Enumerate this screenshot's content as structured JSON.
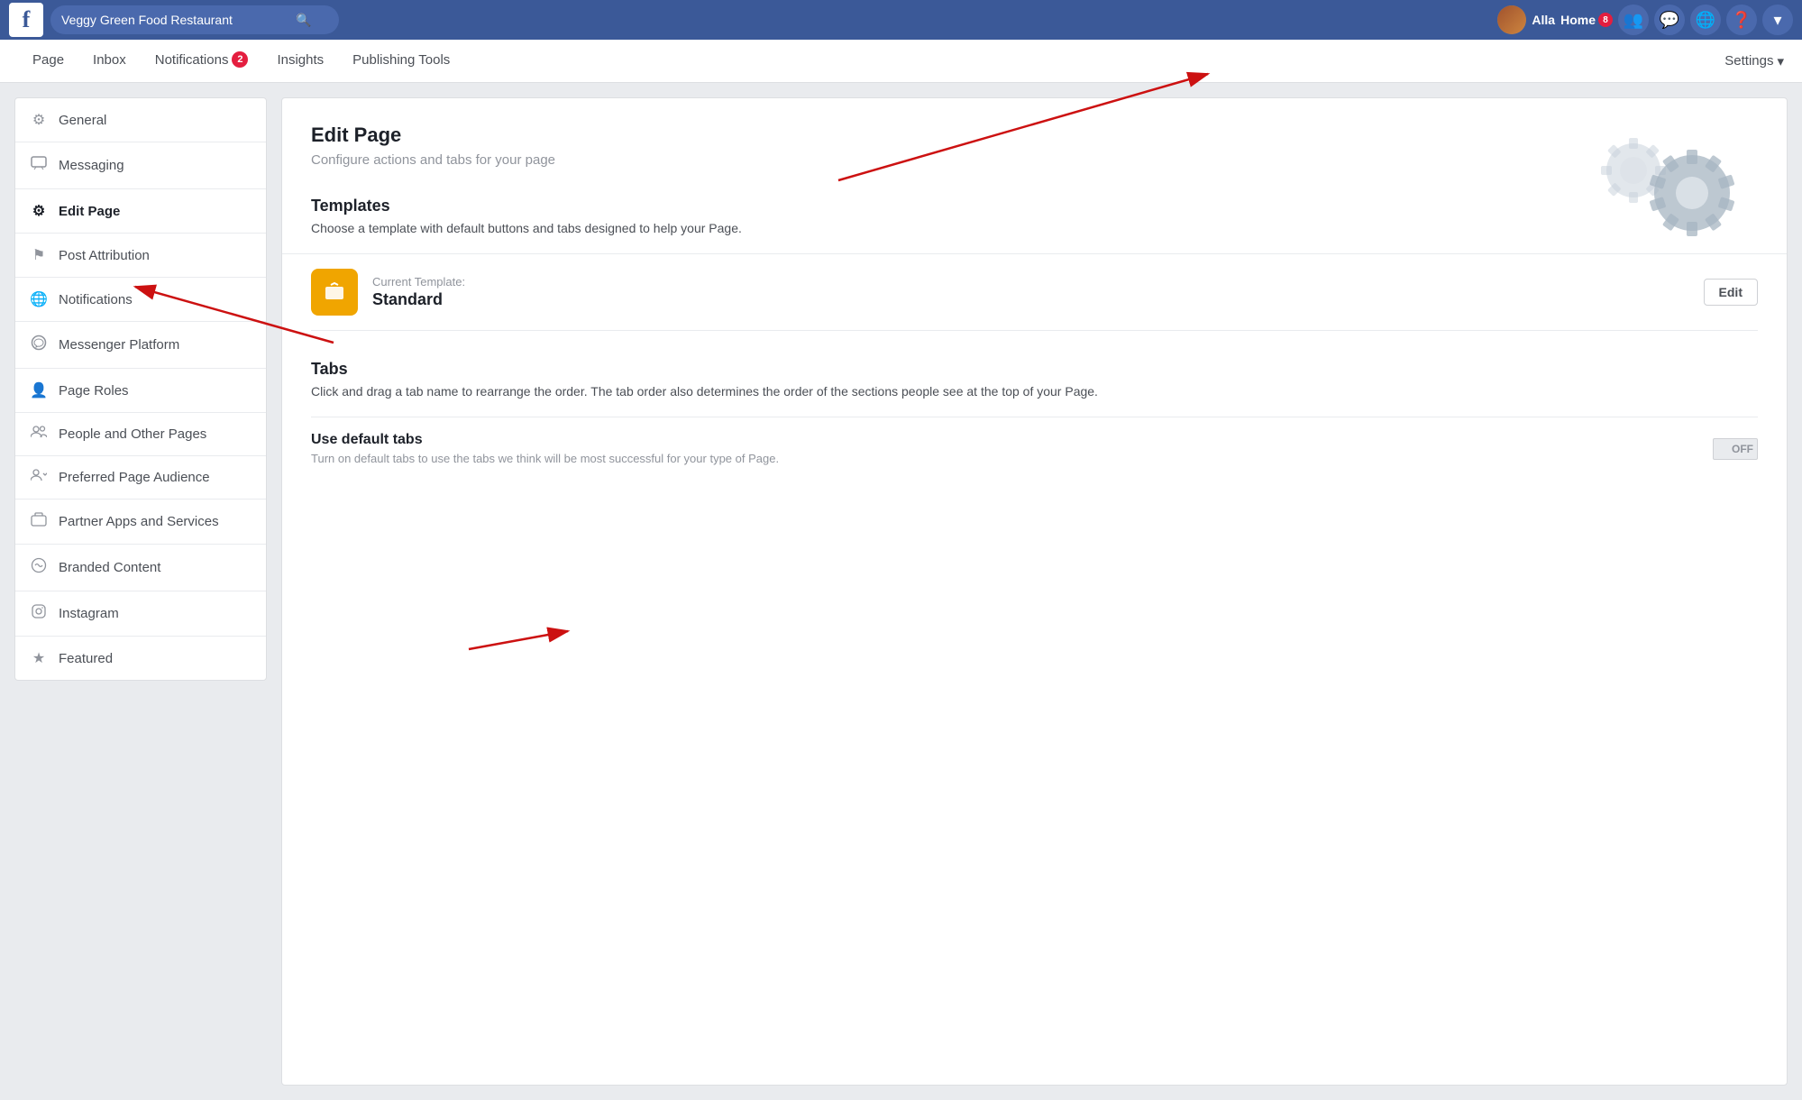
{
  "topNav": {
    "logo": "f",
    "searchPlaceholder": "Veggy Green Food Restaurant",
    "username": "Alla",
    "homeLabel": "Home",
    "homeBadge": "8",
    "icons": [
      "friends-icon",
      "messenger-icon",
      "globe-icon",
      "help-icon",
      "dropdown-icon"
    ]
  },
  "pageNav": {
    "items": [
      {
        "id": "page",
        "label": "Page",
        "active": false
      },
      {
        "id": "inbox",
        "label": "Inbox",
        "active": false
      },
      {
        "id": "notifications",
        "label": "Notifications",
        "badge": "2",
        "active": false
      },
      {
        "id": "insights",
        "label": "Insights",
        "active": false
      },
      {
        "id": "publishing-tools",
        "label": "Publishing Tools",
        "active": false
      }
    ],
    "settingsLabel": "Settings",
    "settingsDropdown": "▾"
  },
  "sidebar": {
    "items": [
      {
        "id": "general",
        "label": "General",
        "icon": "⚙"
      },
      {
        "id": "messaging",
        "label": "Messaging",
        "icon": "💬"
      },
      {
        "id": "edit-page",
        "label": "Edit Page",
        "icon": "⚙",
        "active": true
      },
      {
        "id": "post-attribution",
        "label": "Post Attribution",
        "icon": "⚑"
      },
      {
        "id": "notifications",
        "label": "Notifications",
        "icon": "🌐"
      },
      {
        "id": "messenger-platform",
        "label": "Messenger Platform",
        "icon": "☺"
      },
      {
        "id": "page-roles",
        "label": "Page Roles",
        "icon": "👤"
      },
      {
        "id": "people-other-pages",
        "label": "People and Other Pages",
        "icon": "👥"
      },
      {
        "id": "preferred-page-audience",
        "label": "Preferred Page Audience",
        "icon": "👥"
      },
      {
        "id": "partner-apps",
        "label": "Partner Apps and Services",
        "icon": "📦"
      },
      {
        "id": "branded-content",
        "label": "Branded Content",
        "icon": "🏷"
      },
      {
        "id": "instagram",
        "label": "Instagram",
        "icon": "⊙"
      },
      {
        "id": "featured",
        "label": "Featured",
        "icon": "★"
      }
    ]
  },
  "content": {
    "header": {
      "title": "Edit Page",
      "subtitle": "Configure actions and tabs for your page"
    },
    "templates": {
      "sectionTitle": "Templates",
      "sectionDesc": "Choose a template with default buttons and tabs designed to help your Page.",
      "currentLabel": "Current Template:",
      "currentName": "Standard",
      "editButtonLabel": "Edit"
    },
    "tabs": {
      "sectionTitle": "Tabs",
      "sectionDesc": "Click and drag a tab name to rearrange the order. The tab order also determines the order of the sections people see at the top of your Page.",
      "defaultTabsLabel": "Use default tabs",
      "defaultTabsDesc": "Turn on default tabs to use the tabs we think will be most successful for your type of Page.",
      "toggleState": "OFF"
    }
  }
}
